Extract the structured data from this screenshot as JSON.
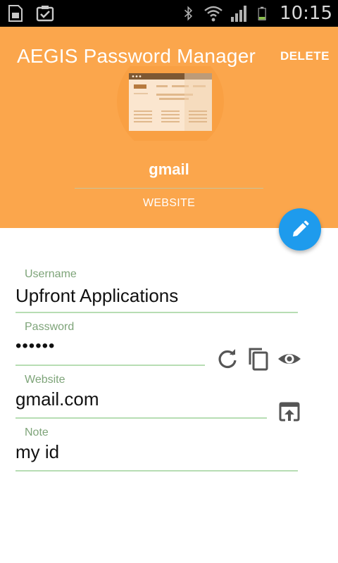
{
  "app": {
    "title": "AEGIS Password Manager",
    "delete_label": "DELETE"
  },
  "status_bar": {
    "time": "10:15",
    "icons": [
      "sim-card-icon",
      "clipboard-check-icon",
      "bluetooth-icon",
      "wifi-icon",
      "signal-icon",
      "battery-icon"
    ]
  },
  "entry": {
    "name": "gmail",
    "category": "WEBSITE",
    "illustration": "website-browser-icon"
  },
  "fields": {
    "username": {
      "label": "Username",
      "value": "Upfront Applications"
    },
    "password": {
      "label": "Password",
      "value": "••••••",
      "actions": [
        "refresh-icon",
        "copy-icon",
        "eye-icon"
      ]
    },
    "website": {
      "label": "Website",
      "value": "gmail.com",
      "actions": [
        "open-in-browser-icon"
      ]
    },
    "note": {
      "label": "Note",
      "value": "my id"
    }
  },
  "fab": {
    "icon": "edit-pencil-icon"
  },
  "colors": {
    "header": "#fba64c",
    "fab": "#1e9bed",
    "label": "#7ea479",
    "underline": "#b7ddb3",
    "status_bar": "#000000"
  }
}
